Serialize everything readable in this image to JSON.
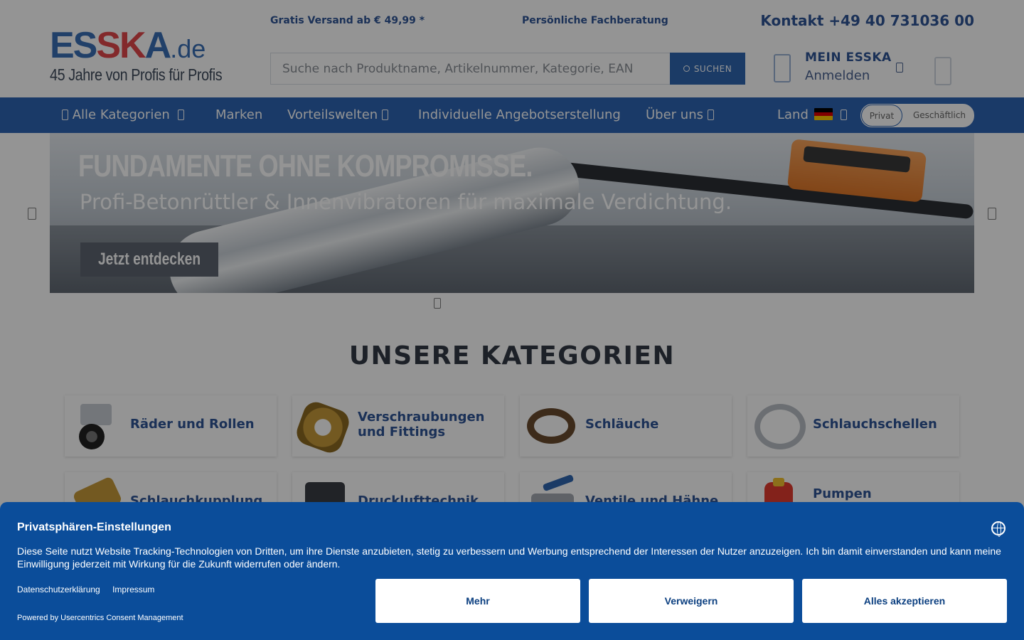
{
  "header": {
    "logo": {
      "brand_1": "ES",
      "brand_2": "SK",
      "brand_3": "A",
      "tld": ".de",
      "tagline": "45 Jahre von Profis für Profis"
    },
    "usp_shipping": "Gratis Versand ab € 49,99 *",
    "usp_advice": "Persönliche Fachberatung",
    "contact": "Kontakt +49 40 731036 00",
    "search": {
      "placeholder": "Suche nach Produktname, Artikelnummer, Kategorie, EAN",
      "button_label": "SUCHEN"
    },
    "account": {
      "title": "MEIN ESSKA",
      "subtitle": "Anmelden"
    }
  },
  "nav": {
    "items": [
      {
        "label": "Alle Kategorien"
      },
      {
        "label": "Marken"
      },
      {
        "label": "Vorteilswelten"
      },
      {
        "label": "Individuelle Angebotserstellung"
      },
      {
        "label": "Über uns"
      }
    ],
    "country_label": "Land",
    "customer_type": {
      "private": "Privat",
      "business": "Geschäftlich",
      "selected": "private"
    }
  },
  "hero": {
    "headline": "FUNDAMENTE OHNE KOMPROMISSE.",
    "subline": "Profi-Betonrüttler & Innenvibratoren für maximale Verdichtung.",
    "cta": "Jetzt entdecken"
  },
  "categories": {
    "title": "UNSERE KATEGORIEN",
    "items": [
      {
        "label": "Räder und Rollen",
        "icon": "wheel-icon"
      },
      {
        "label": "Verschraubungen und Fittings",
        "icon": "fitting-icon"
      },
      {
        "label": "Schläuche",
        "icon": "hose-icon"
      },
      {
        "label": "Schlauchschellen",
        "icon": "clamp-icon"
      },
      {
        "label": "Schlauchkupplung",
        "icon": "coupling-icon"
      },
      {
        "label": "Drucklufttechnik",
        "icon": "compressor-icon"
      },
      {
        "label": "Ventile und Hähne",
        "icon": "valve-icon"
      },
      {
        "label": "Pumpen",
        "icon": "pump-icon"
      }
    ]
  },
  "consent": {
    "title": "Privatsphären-Einstellungen",
    "text": "Diese Seite nutzt Website Tracking-Technologien von Dritten, um ihre Dienste anzubieten, stetig zu verbessern und Werbung entsprechend der Interessen der Nutzer anzuzeigen. Ich bin damit einverstanden und kann meine Einwilligung jederzeit mit Wirkung für die Zukunft widerrufen oder ändern.",
    "link_privacy": "Datenschutzerklärung",
    "link_imprint": "Impressum",
    "powered_by": "Powered by Usercentrics Consent Management",
    "btn_more": "Mehr",
    "btn_deny": "Verweigern",
    "btn_accept": "Alles akzeptieren"
  },
  "colors": {
    "brand_blue": "#2d64b3",
    "brand_red": "#e2474b",
    "consent_blue": "#0b4d9a",
    "overlay": "rgba(0,0,0,0.42)"
  }
}
